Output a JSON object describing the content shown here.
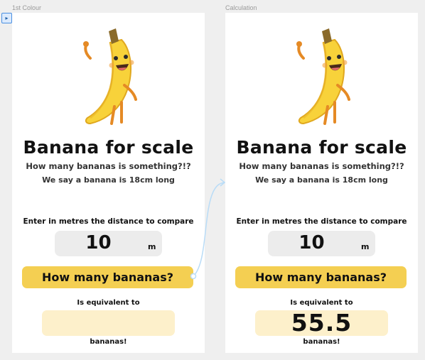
{
  "colors": {
    "canvas": "#efefef",
    "frame": "#ffffff",
    "button": "#f4cf52",
    "input_bg": "#ececec",
    "result_bg": "#fdf0cb",
    "connector": "#b9dcf7",
    "banana": "#f8d23a"
  },
  "canvas": {
    "tool_icon": "cursor-select-icon"
  },
  "frames": [
    {
      "label": "1st Colour",
      "title": "Banana for scale",
      "subtitle": "How many bananas is something?!?",
      "note": "We say a banana is 18cm long",
      "enter_label": "Enter in metres the distance to compare",
      "input_value": "10",
      "input_unit": "m",
      "button_label": "How many bananas?",
      "equiv_label": "Is equivalent to",
      "result_value": "",
      "bananas_label": "bananas!"
    },
    {
      "label": "Calculation",
      "title": "Banana for scale",
      "subtitle": "How many bananas is something?!?",
      "note": "We say a banana is 18cm long",
      "enter_label": "Enter in metres the distance to compare",
      "input_value": "10",
      "input_unit": "m",
      "button_label": "How many bananas?",
      "equiv_label": "Is equivalent to",
      "result_value": "55.5",
      "bananas_label": "bananas!"
    }
  ]
}
